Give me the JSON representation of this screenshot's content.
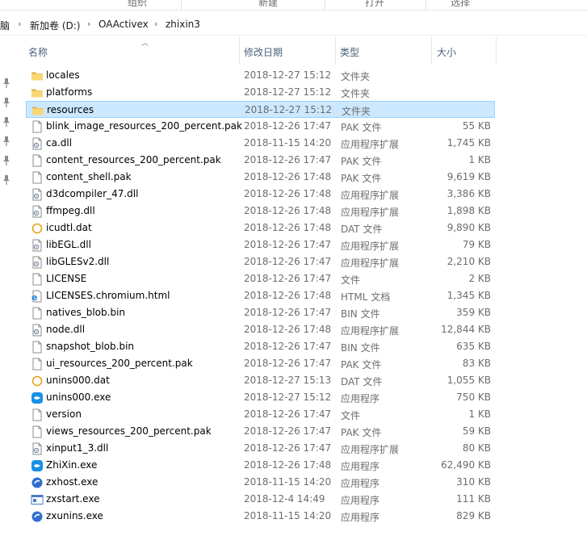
{
  "ribbon": {
    "groups": [
      "组织",
      "新建",
      "打开",
      "选择"
    ]
  },
  "address": {
    "crumbs": [
      "脑",
      "新加卷 (D:)",
      "OAActivex",
      "zhixin3"
    ]
  },
  "columns": {
    "name": "名称",
    "date": "修改日期",
    "type": "类型",
    "size": "大小"
  },
  "files": [
    {
      "name": "locales",
      "date": "2018-12-27 15:12",
      "type": "文件夹",
      "size": "",
      "icon": "folder-icon"
    },
    {
      "name": "platforms",
      "date": "2018-12-27 15:12",
      "type": "文件夹",
      "size": "",
      "icon": "folder-icon"
    },
    {
      "name": "resources",
      "date": "2018-12-27 15:12",
      "type": "文件夹",
      "size": "",
      "icon": "folder-icon",
      "selected": true
    },
    {
      "name": "blink_image_resources_200_percent.pak",
      "date": "2018-12-26 17:47",
      "type": "PAK 文件",
      "size": "55 KB",
      "icon": "file-icon"
    },
    {
      "name": "ca.dll",
      "date": "2018-11-15 14:20",
      "type": "应用程序扩展",
      "size": "1,745 KB",
      "icon": "dll-icon"
    },
    {
      "name": "content_resources_200_percent.pak",
      "date": "2018-12-26 17:47",
      "type": "PAK 文件",
      "size": "1 KB",
      "icon": "file-icon"
    },
    {
      "name": "content_shell.pak",
      "date": "2018-12-26 17:48",
      "type": "PAK 文件",
      "size": "9,619 KB",
      "icon": "file-icon"
    },
    {
      "name": "d3dcompiler_47.dll",
      "date": "2018-12-26 17:48",
      "type": "应用程序扩展",
      "size": "3,386 KB",
      "icon": "dll-icon"
    },
    {
      "name": "ffmpeg.dll",
      "date": "2018-12-26 17:48",
      "type": "应用程序扩展",
      "size": "1,898 KB",
      "icon": "dll-icon"
    },
    {
      "name": "icudtl.dat",
      "date": "2018-12-26 17:48",
      "type": "DAT 文件",
      "size": "9,890 KB",
      "icon": "dat-icon"
    },
    {
      "name": "libEGL.dll",
      "date": "2018-12-26 17:47",
      "type": "应用程序扩展",
      "size": "79 KB",
      "icon": "dll-icon"
    },
    {
      "name": "libGLESv2.dll",
      "date": "2018-12-26 17:47",
      "type": "应用程序扩展",
      "size": "2,210 KB",
      "icon": "dll-icon"
    },
    {
      "name": "LICENSE",
      "date": "2018-12-26 17:47",
      "type": "文件",
      "size": "2 KB",
      "icon": "file-icon"
    },
    {
      "name": "LICENSES.chromium.html",
      "date": "2018-12-26 17:48",
      "type": "HTML 文档",
      "size": "1,345 KB",
      "icon": "html-icon"
    },
    {
      "name": "natives_blob.bin",
      "date": "2018-12-26 17:47",
      "type": "BIN 文件",
      "size": "359 KB",
      "icon": "file-icon"
    },
    {
      "name": "node.dll",
      "date": "2018-12-26 17:48",
      "type": "应用程序扩展",
      "size": "12,844 KB",
      "icon": "dll-icon"
    },
    {
      "name": "snapshot_blob.bin",
      "date": "2018-12-26 17:47",
      "type": "BIN 文件",
      "size": "635 KB",
      "icon": "file-icon"
    },
    {
      "name": "ui_resources_200_percent.pak",
      "date": "2018-12-26 17:47",
      "type": "PAK 文件",
      "size": "83 KB",
      "icon": "file-icon"
    },
    {
      "name": "unins000.dat",
      "date": "2018-12-27 15:13",
      "type": "DAT 文件",
      "size": "1,055 KB",
      "icon": "dat-icon"
    },
    {
      "name": "unins000.exe",
      "date": "2018-12-27 15:12",
      "type": "应用程序",
      "size": "750 KB",
      "icon": "app-icon"
    },
    {
      "name": "version",
      "date": "2018-12-26 17:47",
      "type": "文件",
      "size": "1 KB",
      "icon": "file-icon"
    },
    {
      "name": "views_resources_200_percent.pak",
      "date": "2018-12-26 17:47",
      "type": "PAK 文件",
      "size": "59 KB",
      "icon": "file-icon"
    },
    {
      "name": "xinput1_3.dll",
      "date": "2018-12-26 17:47",
      "type": "应用程序扩展",
      "size": "80 KB",
      "icon": "dll-icon"
    },
    {
      "name": "ZhiXin.exe",
      "date": "2018-12-26 17:48",
      "type": "应用程序",
      "size": "62,490 KB",
      "icon": "app-icon"
    },
    {
      "name": "zxhost.exe",
      "date": "2018-11-15 14:20",
      "type": "应用程序",
      "size": "310 KB",
      "icon": "app-round-icon"
    },
    {
      "name": "zxstart.exe",
      "date": "2018-12-4 14:49",
      "type": "应用程序",
      "size": "111 KB",
      "icon": "window-app-icon"
    },
    {
      "name": "zxunins.exe",
      "date": "2018-11-15 14:20",
      "type": "应用程序",
      "size": "829 KB",
      "icon": "app-round-icon"
    }
  ],
  "colors": {
    "selection_bg": "#cce8ff",
    "selection_border": "#99d1ff",
    "folder": "#f8d775",
    "header_text": "#4c607a",
    "meta_text": "#6d6d6d"
  }
}
